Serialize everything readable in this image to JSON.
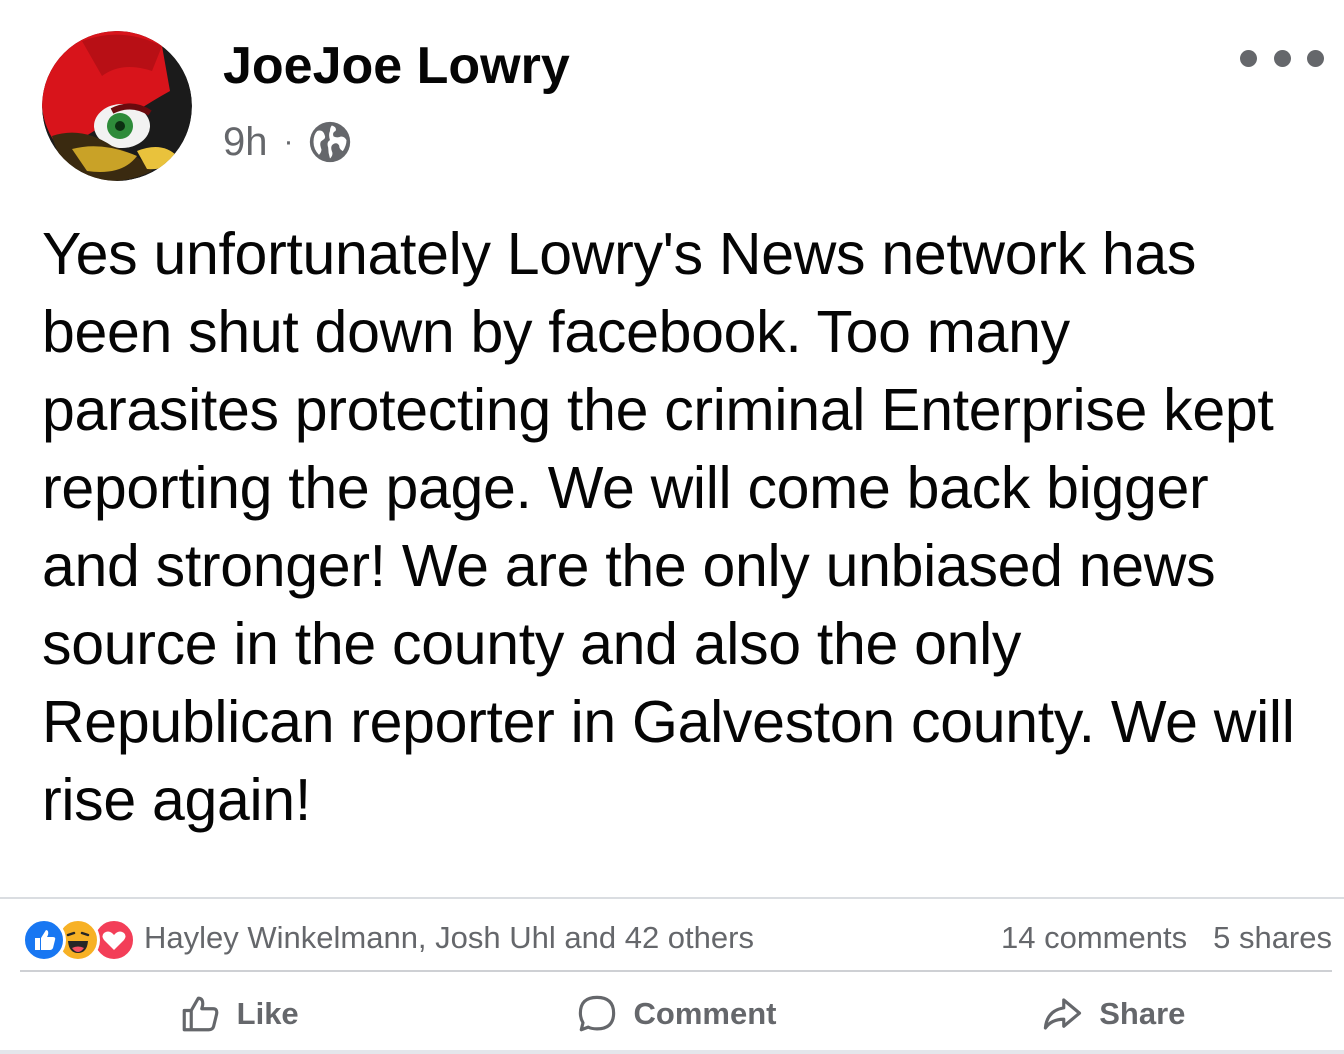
{
  "post": {
    "author": "JoeJoe Lowry",
    "timestamp": "9h",
    "separator": "·",
    "audience_icon": "globe-icon",
    "more_icon": "more-horizontal-icon",
    "text": "Yes unfortunately Lowry's News network has been shut down by facebook. Too many parasites protecting the criminal Enterprise kept reporting the page. We will come back bigger and stronger! We are the only unbiased news source in the county and also the only Republican reporter in Galveston county. We will rise again!"
  },
  "reactions": {
    "icons": [
      "like-reaction-icon",
      "haha-reaction-icon",
      "love-reaction-icon"
    ],
    "summary": "Hayley Winkelmann, Josh Uhl and 42 others",
    "comments": "14 comments",
    "shares": "5 shares"
  },
  "actions": {
    "like_label": "Like",
    "comment_label": "Comment",
    "share_label": "Share"
  },
  "colors": {
    "like_blue": "#1877f2",
    "love_red": "#f33e58",
    "haha_yellow": "#f7b125",
    "secondary_text": "#65676b"
  }
}
